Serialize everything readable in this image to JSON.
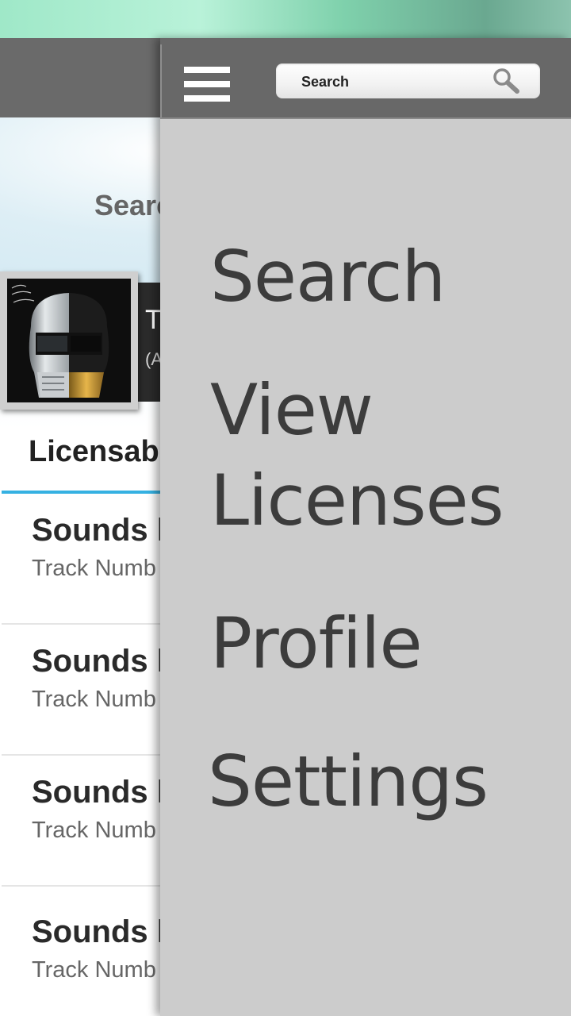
{
  "underlying": {
    "search_label": "Searc",
    "now_playing": {
      "title": "T",
      "subtitle": "(A"
    },
    "section_title": "Licensab",
    "tracks": [
      {
        "title": "Sounds l",
        "subtitle": "Track Numb"
      },
      {
        "title": "Sounds l",
        "subtitle": "Track Numb"
      },
      {
        "title": "Sounds l",
        "subtitle": "Track Numb"
      },
      {
        "title": "Sounds l",
        "subtitle": "Track Numb"
      }
    ]
  },
  "drawer": {
    "search": {
      "placeholder": "Search"
    },
    "menu": [
      {
        "label": "Search"
      },
      {
        "label": "View"
      },
      {
        "label": "Licenses"
      },
      {
        "label": "Profile"
      },
      {
        "label": "Settings"
      }
    ]
  },
  "icons": {
    "menu": "hamburger-menu-icon",
    "search": "magnifier-search-icon"
  },
  "colors": {
    "header_bg": "#686868",
    "drawer_bg": "#cccccc",
    "accent_rule": "#35b1e2",
    "menu_text": "#3c3c3c"
  }
}
